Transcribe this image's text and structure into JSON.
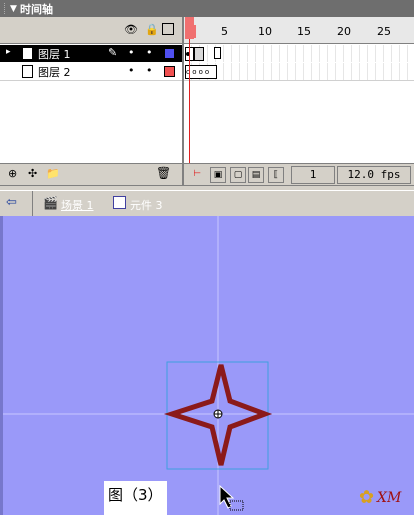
{
  "timeline": {
    "title": "时间轴",
    "layers": [
      {
        "name": "图层 1",
        "selected": true,
        "color": "#5050f0"
      },
      {
        "name": "图层 2",
        "selected": false,
        "color": "#f05050"
      }
    ],
    "ruler": [
      "1",
      "5",
      "10",
      "15",
      "20",
      "25"
    ],
    "current_frame": "1",
    "fps": "12.0 fps"
  },
  "breadcrumb": {
    "scene": "场景 1",
    "symbol": "元件 3"
  },
  "stage": {
    "background": "#9a99f9",
    "star_color": "#8b1a1a",
    "caption": "图（3）",
    "watermark": "XM"
  }
}
